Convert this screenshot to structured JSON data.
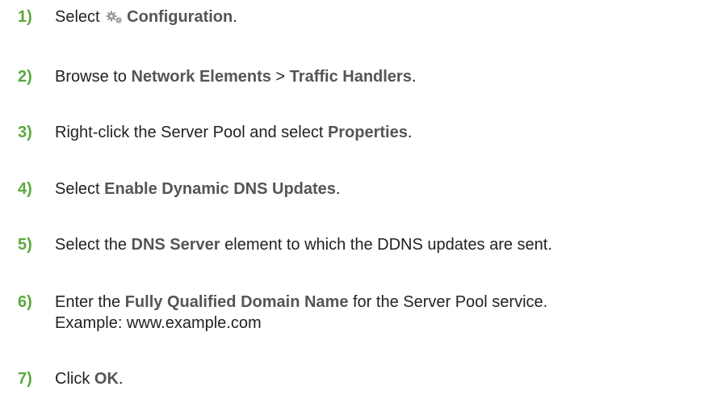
{
  "steps": [
    {
      "number": "1)",
      "parts": [
        "Select",
        " ",
        "Configuration",
        "."
      ],
      "icon": "gears-icon"
    },
    {
      "number": "2)",
      "parts": [
        "Browse to ",
        "Network Elements",
        " > ",
        "Traffic Handlers",
        "."
      ]
    },
    {
      "number": "3)",
      "parts": [
        "Right-click the Server Pool and select ",
        "Properties",
        "."
      ]
    },
    {
      "number": "4)",
      "parts": [
        "Select ",
        "Enable Dynamic DNS Updates",
        "."
      ]
    },
    {
      "number": "5)",
      "parts": [
        "Select the ",
        "DNS Server",
        " element to which the DDNS updates are sent."
      ]
    },
    {
      "number": "6)",
      "parts": [
        "Enter the ",
        "Fully Qualified Domain Name",
        " for the Server Pool service."
      ],
      "subline": "Example: www.example.com"
    },
    {
      "number": "7)",
      "parts": [
        "Click ",
        "OK",
        "."
      ]
    }
  ],
  "colors": {
    "step_number": "#5aaa3c",
    "emphasis": "#555555",
    "body_text": "#222222"
  }
}
